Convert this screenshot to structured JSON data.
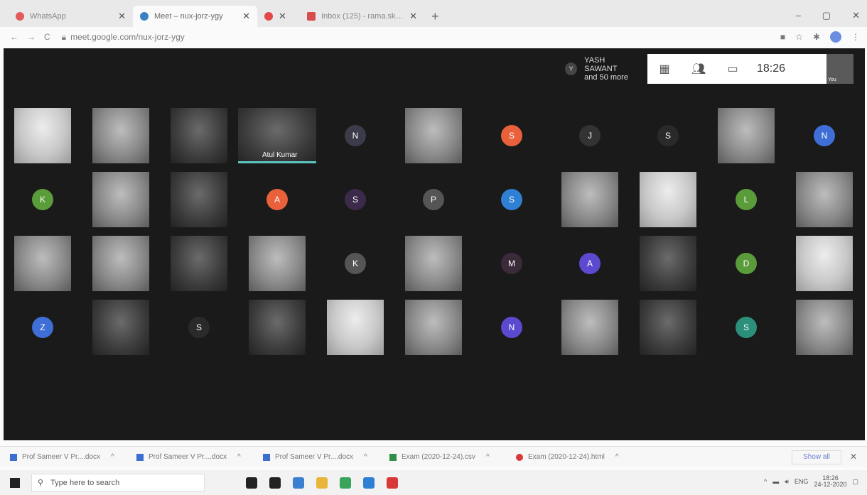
{
  "browser": {
    "tabs": [
      {
        "label": "WhatsApp",
        "color": "#e35a5a",
        "active": false
      },
      {
        "label": "Meet – nux-jorz-ygy",
        "color": "#3b82c4",
        "active": true
      },
      {
        "label": "",
        "color": "#e34747",
        "active": false
      },
      {
        "label": "Inbox (125) - rama.skes@gmail.c",
        "color": "#d94c4c",
        "active": false
      }
    ],
    "new_tab": "+",
    "url": "meet.google.com/nux-jorz-ygy",
    "window_controls": {
      "minimize": "–",
      "maximize": "▢",
      "close": "✕"
    }
  },
  "meet": {
    "presenter": {
      "initial": "Y",
      "line1": "YASH SAWANT",
      "line2": "and 50 more"
    },
    "clock": "18:26",
    "self_label": "You",
    "tiles": [
      {
        "kind": "video",
        "tone": "light"
      },
      {
        "kind": "video",
        "tone": "normal"
      },
      {
        "kind": "video",
        "tone": "dark"
      },
      {
        "kind": "video",
        "tone": "dark",
        "label": "Atul Kumar"
      },
      {
        "kind": "avatar",
        "letter": "N",
        "color": "#3b3b4a"
      },
      {
        "kind": "video",
        "tone": "normal"
      },
      {
        "kind": "avatar",
        "letter": "S",
        "color": "#e8613a"
      },
      {
        "kind": "avatar",
        "letter": "J",
        "color": "#333333"
      },
      {
        "kind": "avatar",
        "letter": "S",
        "color": "#2a2a2a"
      },
      {
        "kind": "video",
        "tone": "normal"
      },
      {
        "kind": "avatar",
        "letter": "N",
        "color": "#3f6fd6"
      },
      {
        "kind": "avatar",
        "letter": "K",
        "color": "#5a9b3a"
      },
      {
        "kind": "video",
        "tone": "normal"
      },
      {
        "kind": "video",
        "tone": "dark"
      },
      {
        "kind": "avatar",
        "letter": "A",
        "color": "#e8613a"
      },
      {
        "kind": "avatar",
        "letter": "S",
        "color": "#3b2a4a"
      },
      {
        "kind": "avatar",
        "letter": "P",
        "color": "#555555"
      },
      {
        "kind": "avatar",
        "letter": "S",
        "color": "#2f7fd2"
      },
      {
        "kind": "video",
        "tone": "normal"
      },
      {
        "kind": "video",
        "tone": "light"
      },
      {
        "kind": "avatar",
        "letter": "L",
        "color": "#5a9b3a"
      },
      {
        "kind": "video",
        "tone": "normal"
      },
      {
        "kind": "video",
        "tone": "normal"
      },
      {
        "kind": "video",
        "tone": "normal"
      },
      {
        "kind": "video",
        "tone": "dark"
      },
      {
        "kind": "video",
        "tone": "normal"
      },
      {
        "kind": "avatar",
        "letter": "K",
        "color": "#555555"
      },
      {
        "kind": "video",
        "tone": "normal"
      },
      {
        "kind": "avatar",
        "letter": "M",
        "color": "#3b2a3a"
      },
      {
        "kind": "avatar",
        "letter": "A",
        "color": "#5b4ad0"
      },
      {
        "kind": "video",
        "tone": "dark"
      },
      {
        "kind": "avatar",
        "letter": "D",
        "color": "#5a9b3a"
      },
      {
        "kind": "video",
        "tone": "light"
      },
      {
        "kind": "avatar",
        "letter": "Z",
        "color": "#3f6fd6"
      },
      {
        "kind": "video",
        "tone": "dark"
      },
      {
        "kind": "avatar",
        "letter": "S",
        "color": "#2a2a2a"
      },
      {
        "kind": "video",
        "tone": "dark"
      },
      {
        "kind": "video",
        "tone": "light"
      },
      {
        "kind": "video",
        "tone": "normal"
      },
      {
        "kind": "avatar",
        "letter": "N",
        "color": "#5b4ad0"
      },
      {
        "kind": "video",
        "tone": "normal"
      },
      {
        "kind": "video",
        "tone": "dark"
      },
      {
        "kind": "avatar",
        "letter": "S",
        "color": "#2b8f7a"
      },
      {
        "kind": "video",
        "tone": "normal"
      }
    ]
  },
  "downloads": {
    "items": [
      {
        "name": "Prof Sameer V Pr....docx",
        "color": "#3b6fd0"
      },
      {
        "name": "Prof Sameer V Pr....docx",
        "color": "#3b6fd0"
      },
      {
        "name": "Prof Sameer V Pr....docx",
        "color": "#3b6fd0"
      },
      {
        "name": "Exam (2020-12-24).csv",
        "color": "#2f8f4a"
      },
      {
        "name": "Exam (2020-12-24).html",
        "color": "#d83838"
      }
    ],
    "show_all": "Show all",
    "close": "✕"
  },
  "taskbar": {
    "search_placeholder": "Type here to search",
    "language": "ENG",
    "time": "18:26",
    "date": "24-12-2020",
    "apps": [
      {
        "name": "cortana-icon",
        "color": "#222222"
      },
      {
        "name": "task-view-icon",
        "color": "#222222"
      },
      {
        "name": "store-icon",
        "color": "#3b7fd0"
      },
      {
        "name": "file-explorer-icon",
        "color": "#e8b63a"
      },
      {
        "name": "chrome-icon",
        "color": "#3aa55a"
      },
      {
        "name": "outlook-icon",
        "color": "#2f7fd2"
      },
      {
        "name": "opera-icon",
        "color": "#d83838"
      }
    ]
  }
}
